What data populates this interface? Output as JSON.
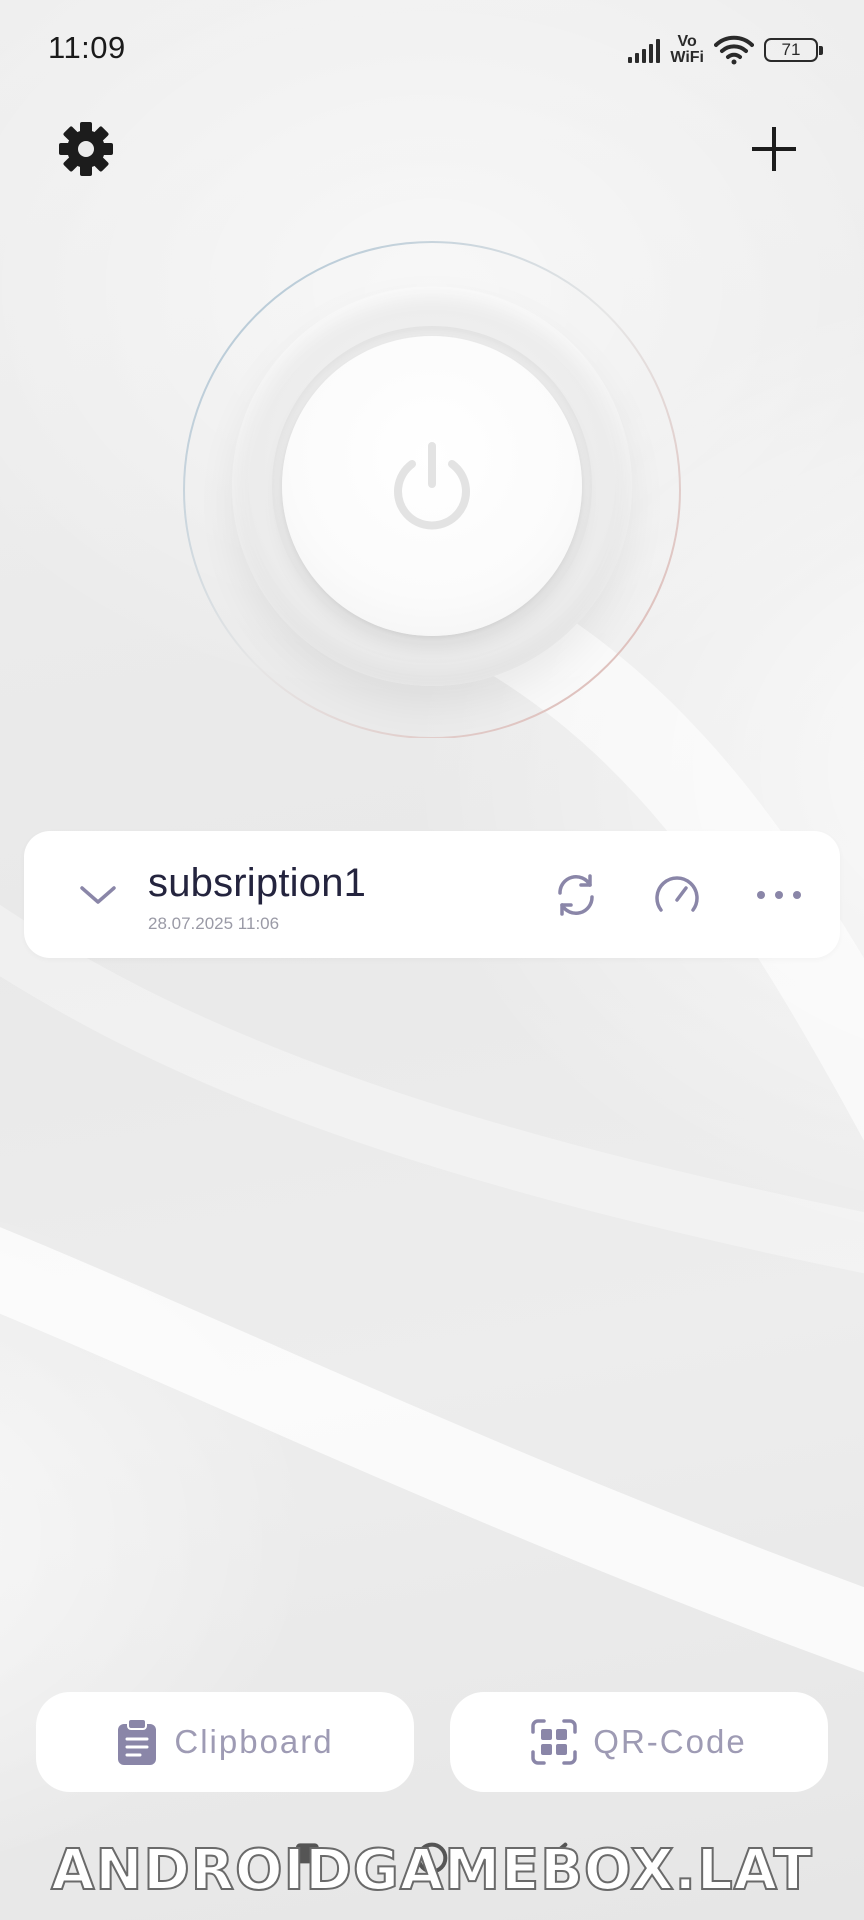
{
  "status_bar": {
    "time": "11:09",
    "network_label_top": "Vo",
    "network_label_bottom": "WiFi",
    "battery": "71"
  },
  "toolbar": {
    "settings_icon": "gear-icon",
    "add_icon": "plus-icon"
  },
  "power": {
    "icon": "power-icon",
    "state": "disconnected"
  },
  "subscription": {
    "name": "subsription1",
    "updated": "28.07.2025 11:06",
    "icons": [
      "chevron-down-icon",
      "refresh-icon",
      "speedometer-icon",
      "more-icon"
    ]
  },
  "actions": {
    "clipboard_label": "Clipboard",
    "qr_label": "QR-Code"
  },
  "watermark": "ANDROIDGAMEBOX.LAT",
  "colors": {
    "accent": "#8a86a8",
    "icon_dark": "#1c1c1c",
    "card_bg": "#ffffff",
    "ring_blue": "#a9c2d3",
    "ring_pink": "#dcb3ae"
  }
}
